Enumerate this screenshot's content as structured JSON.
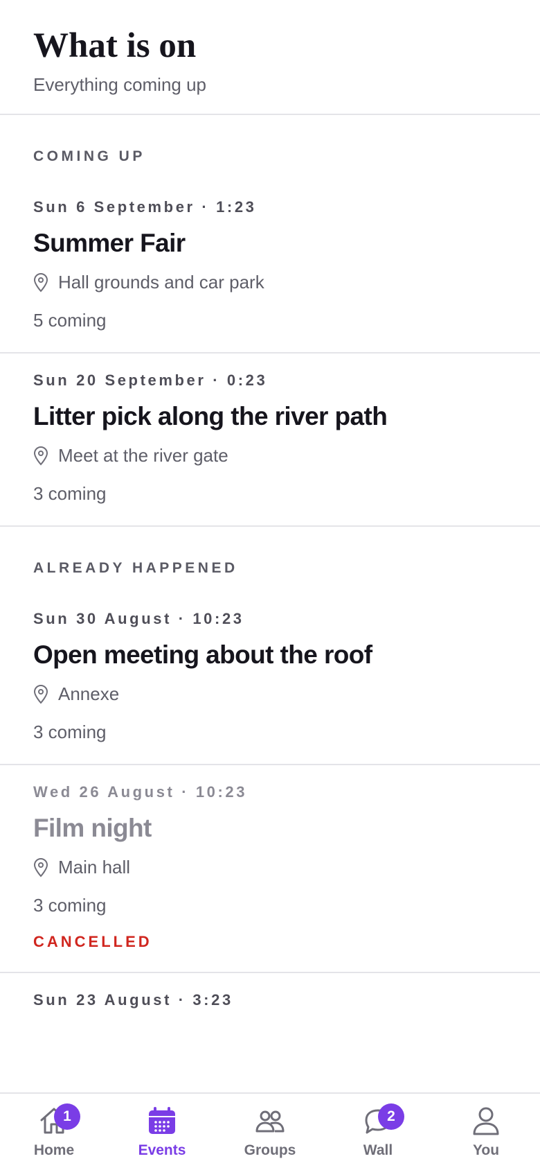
{
  "header": {
    "title": "What is on",
    "subtitle": "Everything coming up"
  },
  "sections": {
    "upcoming": {
      "label": "COMING UP",
      "events": [
        {
          "date": "Sun 6 September · 1:23",
          "title": "Summer Fair",
          "location": "Hall grounds and car park",
          "coming": "5 coming"
        },
        {
          "date": "Sun 20 September · 0:23",
          "title": "Litter pick along the river path",
          "location": "Meet at the river gate",
          "coming": "3 coming"
        }
      ]
    },
    "past": {
      "label": "ALREADY HAPPENED",
      "events": [
        {
          "date": "Sun 30 August · 10:23",
          "title": "Open meeting about the roof",
          "location": "Annexe",
          "coming": "3 coming"
        },
        {
          "date": "Wed 26 August · 10:23",
          "title": "Film night",
          "location": "Main hall",
          "coming": "3 coming",
          "status": "CANCELLED"
        },
        {
          "date": "Sun 23 August · 3:23"
        }
      ]
    }
  },
  "tabbar": {
    "home": {
      "label": "Home",
      "badge": "1",
      "icon": "home-icon"
    },
    "events": {
      "label": "Events",
      "icon": "calendar-icon"
    },
    "groups": {
      "label": "Groups",
      "icon": "people-icon"
    },
    "wall": {
      "label": "Wall",
      "badge": "2",
      "icon": "chat-bubble-icon"
    },
    "you": {
      "label": "You",
      "icon": "person-icon"
    }
  },
  "colors": {
    "accent": "#7a3de6",
    "cancelled": "#d0261f",
    "text": "#16151d",
    "muted": "#5e5e68",
    "divider": "#e4e4e8"
  }
}
